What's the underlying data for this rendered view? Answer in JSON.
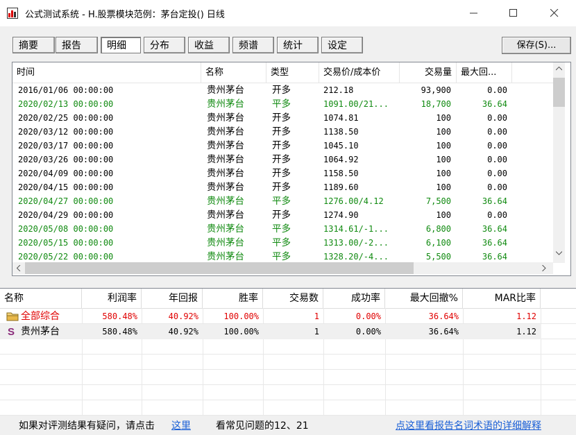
{
  "window": {
    "title": "公式测试系统 - H.股票模块范例：茅台定投() 日线"
  },
  "toolbar": {
    "tabs": [
      {
        "label": "摘要"
      },
      {
        "label": "报告"
      },
      {
        "label": "明细"
      },
      {
        "label": "分布"
      },
      {
        "label": "收益"
      },
      {
        "label": "频谱"
      },
      {
        "label": "统计"
      },
      {
        "label": "设定"
      }
    ],
    "active_tab": "明细",
    "save_label": "保存(S)..."
  },
  "detail_table": {
    "columns": [
      "时间",
      "名称",
      "类型",
      "交易价/成本价",
      "交易量",
      "最大回..."
    ],
    "rows": [
      {
        "time": "2016/01/06 00:00:00",
        "name": "贵州茅台",
        "type": "开多",
        "price": "212.18",
        "volume": "93,900",
        "drawdown": "0.00",
        "close": false
      },
      {
        "time": "2020/02/13 00:00:00",
        "name": "贵州茅台",
        "type": "平多",
        "price": "1091.00/21...",
        "volume": "18,700",
        "drawdown": "36.64",
        "close": true
      },
      {
        "time": "2020/02/25 00:00:00",
        "name": "贵州茅台",
        "type": "开多",
        "price": "1074.81",
        "volume": "100",
        "drawdown": "0.00",
        "close": false
      },
      {
        "time": "2020/03/12 00:00:00",
        "name": "贵州茅台",
        "type": "开多",
        "price": "1138.50",
        "volume": "100",
        "drawdown": "0.00",
        "close": false
      },
      {
        "time": "2020/03/17 00:00:00",
        "name": "贵州茅台",
        "type": "开多",
        "price": "1045.10",
        "volume": "100",
        "drawdown": "0.00",
        "close": false
      },
      {
        "time": "2020/03/26 00:00:00",
        "name": "贵州茅台",
        "type": "开多",
        "price": "1064.92",
        "volume": "100",
        "drawdown": "0.00",
        "close": false
      },
      {
        "time": "2020/04/09 00:00:00",
        "name": "贵州茅台",
        "type": "开多",
        "price": "1158.50",
        "volume": "100",
        "drawdown": "0.00",
        "close": false
      },
      {
        "time": "2020/04/15 00:00:00",
        "name": "贵州茅台",
        "type": "开多",
        "price": "1189.60",
        "volume": "100",
        "drawdown": "0.00",
        "close": false
      },
      {
        "time": "2020/04/27 00:00:00",
        "name": "贵州茅台",
        "type": "平多",
        "price": "1276.00/4.12",
        "volume": "7,500",
        "drawdown": "36.64",
        "close": true
      },
      {
        "time": "2020/04/29 00:00:00",
        "name": "贵州茅台",
        "type": "开多",
        "price": "1274.90",
        "volume": "100",
        "drawdown": "0.00",
        "close": false
      },
      {
        "time": "2020/05/08 00:00:00",
        "name": "贵州茅台",
        "type": "平多",
        "price": "1314.61/-1...",
        "volume": "6,800",
        "drawdown": "36.64",
        "close": true
      },
      {
        "time": "2020/05/15 00:00:00",
        "name": "贵州茅台",
        "type": "平多",
        "price": "1313.00/-2...",
        "volume": "6,100",
        "drawdown": "36.64",
        "close": true
      },
      {
        "time": "2020/05/22 00:00:00",
        "name": "贵州茅台",
        "type": "平多",
        "price": "1328.20/-4...",
        "volume": "5,500",
        "drawdown": "36.64",
        "close": true
      }
    ]
  },
  "summary_table": {
    "columns": [
      "名称",
      "利润率",
      "年回报",
      "胜率",
      "交易数",
      "成功率",
      "最大回撤%",
      "MAR比率"
    ],
    "rows": [
      {
        "icon": "folder-icon",
        "name": "全部综合",
        "profit": "580.48%",
        "annual": "40.92%",
        "winrate": "100.00%",
        "trades": "1",
        "success": "0.00%",
        "maxdd": "36.64%",
        "mar": "1.12",
        "color": "#e00000"
      },
      {
        "icon": "stock-s-icon",
        "name": "贵州茅台",
        "profit": "580.48%",
        "annual": "40.92%",
        "winrate": "100.00%",
        "trades": "1",
        "success": "0.00%",
        "maxdd": "36.64%",
        "mar": "1.12",
        "color": "#000000"
      }
    ]
  },
  "footer": {
    "question_text": "如果对评测结果有疑问，请点击",
    "here_link": "这里",
    "faq_text": "看常见问题的12、21",
    "glossary_link": "点这里看报告名词术语的详细解释"
  },
  "colors": {
    "close_row": "#108a10",
    "summary_total": "#e00000",
    "link": "#1a5fd6"
  }
}
